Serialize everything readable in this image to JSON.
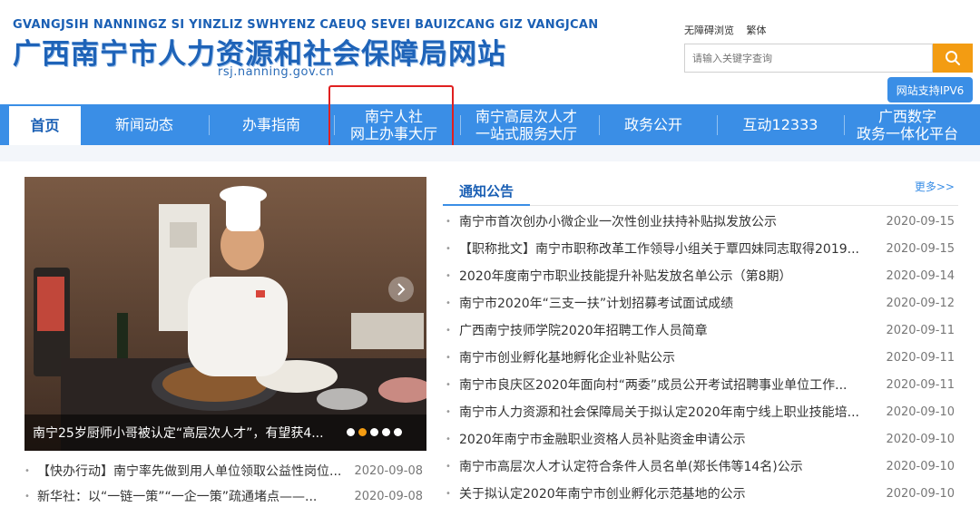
{
  "header": {
    "pinyin": "GVANGJSIH NANNINGZ SI YINZLIZ SWHYENZ CAEUQ SEVEI BAUIZCANG GIZ VANGJCAN",
    "title": "广西南宁市人力资源和社会保障局网站",
    "domain": "rsj.nanning.gov.cn",
    "links": [
      "无障碍浏览",
      "繁体"
    ],
    "search_placeholder": "请输入关键字查询",
    "ipv6": "网站支持IPV6"
  },
  "nav": [
    {
      "label": "首页",
      "active": true
    },
    {
      "label": "新闻动态"
    },
    {
      "label": "办事指南"
    },
    {
      "label": "南宁人社\n网上办事大厅"
    },
    {
      "label": "南宁高层次人才\n一站式服务大厅"
    },
    {
      "label": "政务公开"
    },
    {
      "label": "互动12333"
    },
    {
      "label": "广西数字\n政务一体化平台"
    }
  ],
  "slideshow": {
    "caption": "南宁25岁厨师小哥被认定“高层次人才”，有望获4...",
    "dots": 5,
    "active_dot": 1
  },
  "left_news": [
    {
      "title": "【快办行动】南宁率先做到用人单位领取公益性岗位...",
      "date": "2020-09-08"
    },
    {
      "title": "新华社：以“一链一策”“一企一策”疏通堵点——...",
      "date": "2020-09-08"
    }
  ],
  "notice": {
    "tab": "通知公告",
    "more": "更多>>",
    "items": [
      {
        "title": "南宁市首次创办小微企业一次性创业扶持补贴拟发放公示",
        "date": "2020-09-15"
      },
      {
        "title": "【职称批文】南宁市职称改革工作领导小组关于覃四妹同志取得2019...",
        "date": "2020-09-15"
      },
      {
        "title": "2020年度南宁市职业技能提升补贴发放名单公示（第8期）",
        "date": "2020-09-14"
      },
      {
        "title": "南宁市2020年“三支一扶”计划招募考试面试成绩",
        "date": "2020-09-12"
      },
      {
        "title": "广西南宁技师学院2020年招聘工作人员简章",
        "date": "2020-09-11"
      },
      {
        "title": "南宁市创业孵化基地孵化企业补贴公示",
        "date": "2020-09-11"
      },
      {
        "title": "南宁市良庆区2020年面向村“两委”成员公开考试招聘事业单位工作...",
        "date": "2020-09-11"
      },
      {
        "title": "南宁市人力资源和社会保障局关于拟认定2020年南宁线上职业技能培...",
        "date": "2020-09-10"
      },
      {
        "title": "2020年南宁市金融职业资格人员补贴资金申请公示",
        "date": "2020-09-10"
      },
      {
        "title": "南宁市高层次人才认定符合条件人员名单(郑长伟等14名)公示",
        "date": "2020-09-10"
      },
      {
        "title": "关于拟认定2020年南宁市创业孵化示范基地的公示",
        "date": "2020-09-10"
      }
    ]
  }
}
